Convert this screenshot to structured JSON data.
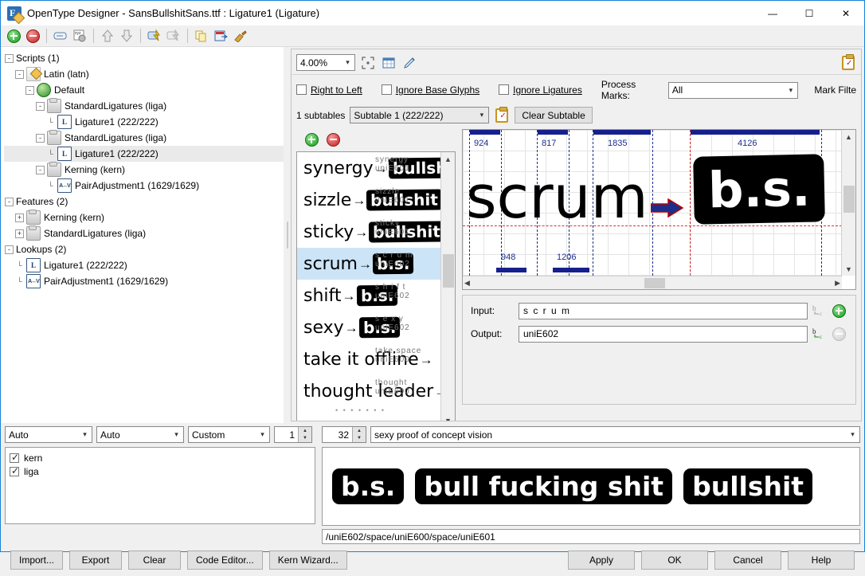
{
  "window": {
    "title": "OpenType Designer - SansBullshitSans.ttf : Ligature1 (Ligature)",
    "minimize": "—",
    "maximize": "☐",
    "close": "✕"
  },
  "toolbar": {
    "items": [
      {
        "name": "add-icon",
        "label": "+"
      },
      {
        "name": "remove-icon",
        "label": "–"
      },
      {
        "name": "rename-icon",
        "label": "▭"
      },
      {
        "name": "glyph-table-icon",
        "label": "xyz"
      },
      {
        "name": "move-up-icon",
        "label": "⇧"
      },
      {
        "name": "move-down-icon",
        "label": "⇩"
      },
      {
        "name": "compile-icon",
        "label": "⚡"
      },
      {
        "name": "compile-all-icon",
        "label": "⚡"
      },
      {
        "name": "copy-icon",
        "label": "❐"
      },
      {
        "name": "paste-icon",
        "label": "▤"
      },
      {
        "name": "clean-icon",
        "label": "✒"
      }
    ]
  },
  "tree": {
    "nodes": [
      {
        "indent": 0,
        "expander": "-",
        "icon": "none",
        "label": "Scripts (1)"
      },
      {
        "indent": 1,
        "expander": "-",
        "icon": "script",
        "label": "Latin (latn)"
      },
      {
        "indent": 2,
        "expander": "-",
        "icon": "globe",
        "label": "Default"
      },
      {
        "indent": 3,
        "expander": "-",
        "icon": "feature",
        "label": "StandardLigatures (liga)"
      },
      {
        "indent": 4,
        "expander": "",
        "icon": "lig",
        "label": "Ligature1 (222/222)"
      },
      {
        "indent": 3,
        "expander": "-",
        "icon": "feature",
        "label": "StandardLigatures (liga)"
      },
      {
        "indent": 4,
        "expander": "",
        "icon": "lig",
        "label": "Ligature1 (222/222)",
        "selected": true
      },
      {
        "indent": 3,
        "expander": "-",
        "icon": "feature",
        "label": "Kerning (kern)"
      },
      {
        "indent": 4,
        "expander": "",
        "icon": "pair",
        "label": "PairAdjustment1 (1629/1629)"
      },
      {
        "indent": 0,
        "expander": "-",
        "icon": "none",
        "label": "Features (2)"
      },
      {
        "indent": 1,
        "expander": "+",
        "icon": "feature",
        "label": "Kerning (kern)"
      },
      {
        "indent": 1,
        "expander": "+",
        "icon": "feature",
        "label": "StandardLigatures (liga)"
      },
      {
        "indent": 0,
        "expander": "-",
        "icon": "none",
        "label": "Lookups (2)"
      },
      {
        "indent": 1,
        "expander": "",
        "icon": "lig",
        "label": "Ligature1 (222/222)"
      },
      {
        "indent": 1,
        "expander": "",
        "icon": "pair",
        "label": "PairAdjustment1 (1629/1629)"
      }
    ]
  },
  "zoom_row": {
    "zoom_value": "4.00%",
    "fit_icon": "fit-selection-icon",
    "table_icon": "glyph-table-icon",
    "pen_icon": "pen-icon",
    "clipboard_icon": "clipboard-check-icon"
  },
  "options": {
    "right_to_left": "Right to Left",
    "ignore_base_glyphs": "Ignore Base Glyphs",
    "ignore_ligatures": "Ignore Ligatures",
    "process_marks_label": "Process Marks:",
    "process_marks_value": "All",
    "mark_filter_label": "Mark Filte"
  },
  "subtable": {
    "count_label": "1 subtables",
    "selected": "Subtable 1 (222/222)",
    "clear_button": "Clear Subtable"
  },
  "glyph_list": {
    "add_label": "+",
    "remove_label": "–",
    "rows": [
      {
        "source": "synergy",
        "result": "bullsh",
        "meta_top": "synergy",
        "meta_bottom": "uniE601"
      },
      {
        "source": "sizzle",
        "result": "bullshit",
        "meta_top": "sizzle",
        "meta_bottom": "uniE601"
      },
      {
        "source": "sticky",
        "result": "bullshit",
        "meta_top": "sticky",
        "meta_bottom": "uniE601"
      },
      {
        "source": "scrum",
        "result": "b.s.",
        "meta_top": "s c r u m",
        "meta_bottom": "uniE602",
        "selected": true
      },
      {
        "source": "shift",
        "result": "b.s.",
        "meta_top": "s h i f t",
        "meta_bottom": "uniE602"
      },
      {
        "source": "sexy",
        "result": "b.s.",
        "meta_top": "s e x y",
        "meta_bottom": "uniE602"
      },
      {
        "source": "take it offline",
        "result": "",
        "meta_top": "take space",
        "meta_bottom": "uniE600"
      },
      {
        "source": "thought leader",
        "result": "",
        "meta_top": "thought",
        "meta_bottom": "uniE600"
      }
    ]
  },
  "canvas": {
    "word": "scrum",
    "result": "b.s.",
    "arrow": "➡",
    "metrics_top": [
      "924",
      "817",
      "1835",
      "4126"
    ],
    "metrics_bottom": [
      "948",
      "1206"
    ]
  },
  "io": {
    "input_label": "Input:",
    "input_value": "s c r u m",
    "output_label": "Output:",
    "output_value": "uniE602",
    "input_add_icon": "add-circle-icon",
    "output_add_icon": "add-circle-disabled-icon",
    "input_bc_icon": "glyph-class-icon",
    "output_bc_icon": "glyph-class-icon"
  },
  "bottom_controls": {
    "script_select": "Auto",
    "language_select": "Auto",
    "direction_select": "Custom",
    "spin_1": "1",
    "spin_2": "32",
    "sample_text": "sexy proof of concept vision"
  },
  "features": {
    "items": [
      {
        "label": "kern",
        "checked": true
      },
      {
        "label": "liga",
        "checked": true
      }
    ]
  },
  "sample_preview": {
    "glyphs": [
      "b.s.",
      "bull fucking shit",
      "bullshit"
    ],
    "status": "/uniE602/space/uniE600/space/uniE601"
  },
  "footer": {
    "buttons_left": [
      "Import...",
      "Export",
      "Clear",
      "Code Editor...",
      "Kern Wizard..."
    ],
    "buttons_right": [
      "Apply",
      "OK",
      "Cancel",
      "Help"
    ]
  },
  "colors": {
    "accent": "#1883d7",
    "selection": "#cce4f7",
    "metric_blue": "#16208c",
    "baseline_red": "#e03030"
  }
}
